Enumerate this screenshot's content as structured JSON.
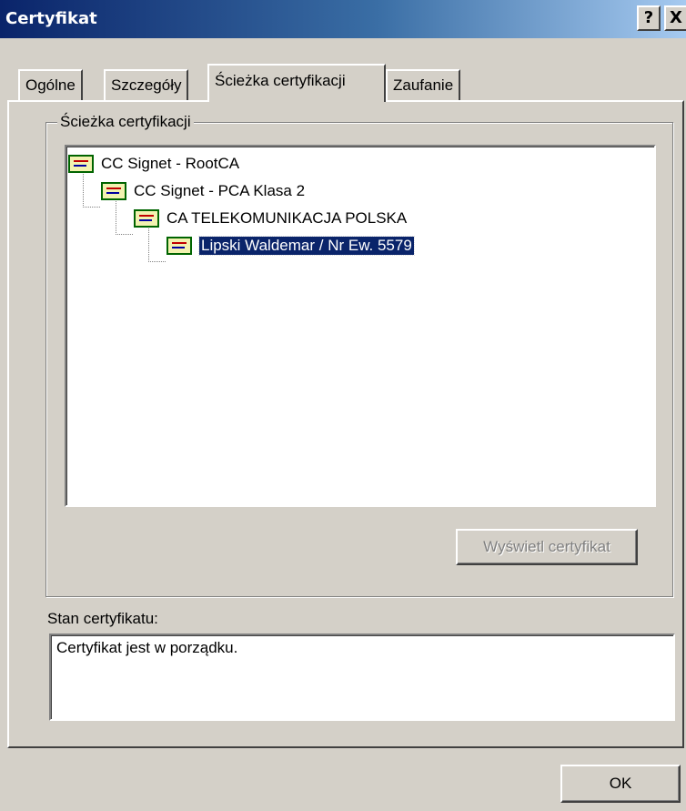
{
  "window": {
    "title": "Certyfikat",
    "help_label": "?",
    "close_label": "X"
  },
  "tabs": [
    {
      "label": "Ogólne",
      "active": false
    },
    {
      "label": "Szczegóły",
      "active": false
    },
    {
      "label": "Ścieżka certyfikacji",
      "active": true
    },
    {
      "label": "Zaufanie",
      "active": false
    }
  ],
  "path_group": {
    "label": "Ścieżka certyfikacji",
    "nodes": [
      {
        "label": "CC Signet - RootCA",
        "level": 0,
        "selected": false
      },
      {
        "label": "CC Signet - PCA Klasa 2",
        "level": 1,
        "selected": false
      },
      {
        "label": "CA TELEKOMUNIKACJA POLSKA",
        "level": 2,
        "selected": false
      },
      {
        "label": "Lipski Waldemar / Nr Ew. 5579",
        "level": 3,
        "selected": true
      }
    ],
    "view_button": "Wyświetl certyfikat"
  },
  "status": {
    "label": "Stan certyfikatu:",
    "text": "Certyfikat jest w porządku."
  },
  "ok_button": "OK"
}
